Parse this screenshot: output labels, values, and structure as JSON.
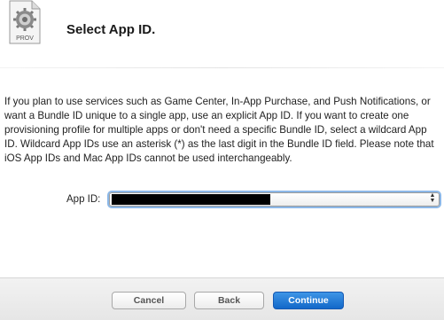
{
  "header": {
    "icon": "provisioning-profile-icon",
    "icon_label": "PROV",
    "title": "Select App ID."
  },
  "main": {
    "description": "If you plan to use services such as Game Center, In-App Purchase, and Push Notifications, or want a Bundle ID unique to a single app, use an explicit App ID. If you want to create one provisioning profile for multiple apps or don't need a specific Bundle ID, select a wildcard App ID. Wildcard App IDs use an asterisk (*) as the last digit in the Bundle ID field. Please note that iOS App IDs and Mac App IDs cannot be used interchangeably.",
    "app_id_label": "App ID:",
    "app_id_selected": ""
  },
  "footer": {
    "cancel_label": "Cancel",
    "back_label": "Back",
    "continue_label": "Continue"
  },
  "colors": {
    "primary_button": "#1268c9",
    "focus_ring": "#8cb8e8"
  }
}
